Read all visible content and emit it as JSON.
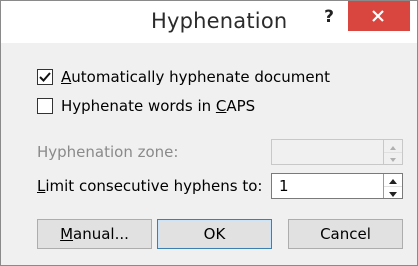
{
  "window": {
    "title": "Hyphenation",
    "help_label": "?",
    "close_icon": "close-icon"
  },
  "options": {
    "auto_hyphenate": {
      "checked": true,
      "label_before": "",
      "label_accel": "A",
      "label_after": "utomatically hyphenate document"
    },
    "hyphenate_caps": {
      "checked": false,
      "label_before": "Hyphenate words in ",
      "label_accel": "C",
      "label_after": "APS"
    }
  },
  "fields": {
    "hyphenation_zone": {
      "label": "Hyphenation zone:",
      "value": "",
      "enabled": false
    },
    "limit_consecutive": {
      "label_accel": "L",
      "label_after": "imit consecutive hyphens to:",
      "value": "1",
      "enabled": true
    }
  },
  "buttons": {
    "manual": {
      "label_accel": "M",
      "label_after": "anual..."
    },
    "ok": {
      "label": "OK"
    },
    "cancel": {
      "label": "Cancel"
    }
  },
  "colors": {
    "close_button": "#d9463f",
    "default_button_border": "#3c7fb1",
    "disabled_text": "#8a8a8a"
  }
}
